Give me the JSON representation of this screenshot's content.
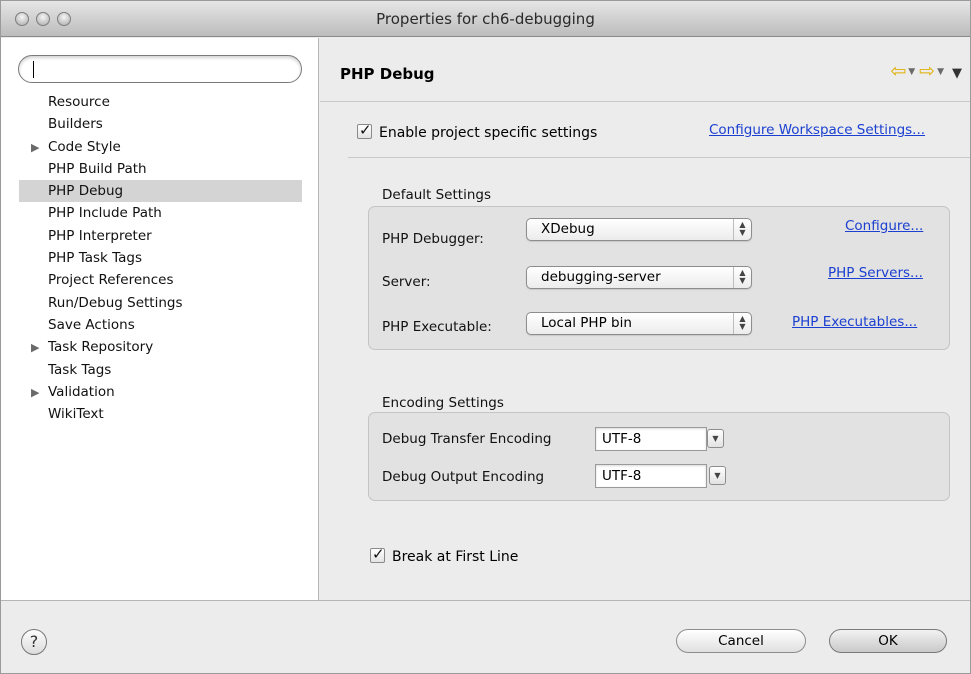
{
  "window": {
    "title": "Properties for ch6-debugging"
  },
  "sidebar": {
    "filter_value": "",
    "items": [
      {
        "label": "Resource",
        "expandable": false,
        "selected": false
      },
      {
        "label": "Builders",
        "expandable": false,
        "selected": false
      },
      {
        "label": "Code Style",
        "expandable": true,
        "selected": false
      },
      {
        "label": "PHP Build Path",
        "expandable": false,
        "selected": false
      },
      {
        "label": "PHP Debug",
        "expandable": false,
        "selected": true
      },
      {
        "label": "PHP Include Path",
        "expandable": false,
        "selected": false
      },
      {
        "label": "PHP Interpreter",
        "expandable": false,
        "selected": false
      },
      {
        "label": "PHP Task Tags",
        "expandable": false,
        "selected": false
      },
      {
        "label": "Project References",
        "expandable": false,
        "selected": false
      },
      {
        "label": "Run/Debug Settings",
        "expandable": false,
        "selected": false
      },
      {
        "label": "Save Actions",
        "expandable": false,
        "selected": false
      },
      {
        "label": "Task Repository",
        "expandable": true,
        "selected": false
      },
      {
        "label": "Task Tags",
        "expandable": false,
        "selected": false
      },
      {
        "label": "Validation",
        "expandable": true,
        "selected": false
      },
      {
        "label": "WikiText",
        "expandable": false,
        "selected": false
      }
    ]
  },
  "main": {
    "page_title": "PHP Debug",
    "enable_specific": {
      "label": "Enable project specific settings",
      "checked": true
    },
    "configure_workspace_link": "Configure Workspace Settings...",
    "default_settings": {
      "title": "Default Settings",
      "debugger": {
        "label": "PHP Debugger:",
        "value": "XDebug",
        "link": "Configure..."
      },
      "server": {
        "label": "Server:",
        "value": "debugging-server",
        "link": "PHP Servers..."
      },
      "executable": {
        "label": "PHP Executable:",
        "value": "Local PHP bin",
        "link": "PHP Executables..."
      }
    },
    "encoding_settings": {
      "title": "Encoding Settings",
      "transfer": {
        "label": "Debug Transfer Encoding",
        "value": "UTF-8"
      },
      "output": {
        "label": "Debug Output Encoding",
        "value": "UTF-8"
      }
    },
    "break_first_line": {
      "label": "Break at First Line",
      "checked": true
    }
  },
  "footer": {
    "help_glyph": "?",
    "cancel_label": "Cancel",
    "ok_label": "OK"
  }
}
